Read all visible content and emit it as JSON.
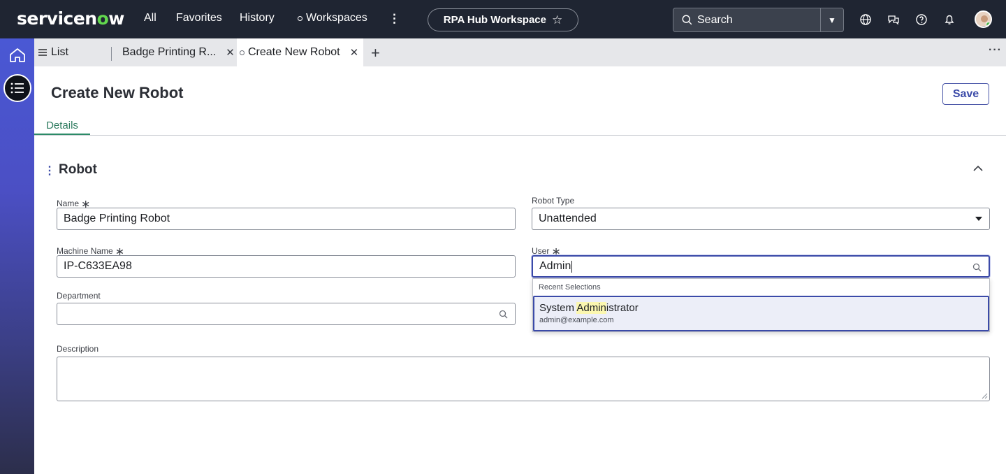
{
  "topnav": {
    "logo_prefix": "servicen",
    "logo_o": "o",
    "logo_suffix": "w",
    "all": "All",
    "favorites": "Favorites",
    "history": "History",
    "workspaces": "Workspaces",
    "workspace_pill": "RPA Hub Workspace",
    "search_placeholder": "Search",
    "icons": [
      "globe-icon",
      "chat-icon",
      "help-icon",
      "bell-icon"
    ]
  },
  "tabs": {
    "list": "List",
    "badge": "Badge Printing R...",
    "active": "Create New Robot"
  },
  "page": {
    "title": "Create New Robot",
    "save": "Save",
    "details_tab": "Details"
  },
  "section": {
    "title": "Robot"
  },
  "fields": {
    "name": {
      "label": "Name",
      "value": "Badge Printing Robot"
    },
    "robot_type": {
      "label": "Robot Type",
      "value": "Unattended"
    },
    "machine_name": {
      "label": "Machine Name",
      "value": "IP-C633EA98"
    },
    "user": {
      "label": "User",
      "value": "Admin"
    },
    "department": {
      "label": "Department",
      "value": ""
    },
    "description": {
      "label": "Description",
      "value": ""
    }
  },
  "dropdown": {
    "header": "Recent Selections",
    "option_name_pre": "System ",
    "option_name_hl": "Admin",
    "option_name_post": "istrator",
    "option_email": "admin@example.com"
  },
  "colors": {
    "topbar": "#1f2532",
    "accent": "#3b4aa8",
    "tab_active": "#2c8a67"
  }
}
